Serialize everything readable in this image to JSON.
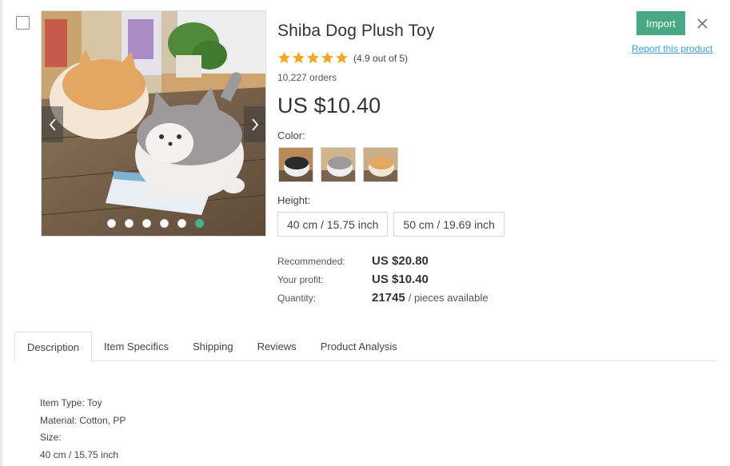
{
  "product": {
    "title": "Shiba Dog Plush Toy",
    "rating_value": 4.9,
    "rating_text": "(4.9 out of 5)",
    "orders": "10,227 orders",
    "price": "US $10.40"
  },
  "actions": {
    "import_label": "Import",
    "report_label": "Report this product"
  },
  "gallery": {
    "image_count": 6,
    "active_index": 5
  },
  "options": {
    "color_label": "Color:",
    "colors": [
      "black-shiba-swatch",
      "grey-shiba-swatch",
      "tan-shiba-swatch"
    ],
    "height_label": "Height:",
    "heights": [
      "40 cm / 15.75 inch",
      "50 cm / 19.69 inch"
    ]
  },
  "stats": {
    "recommended_label": "Recommended:",
    "recommended_value": "US $20.80",
    "profit_label": "Your profit:",
    "profit_value": "US $10.40",
    "quantity_label": "Quantity:",
    "quantity_value": "21745",
    "quantity_unit": "/ pieces available"
  },
  "tabs": [
    {
      "label": "Description",
      "active": true
    },
    {
      "label": "Item Specifics",
      "active": false
    },
    {
      "label": "Shipping",
      "active": false
    },
    {
      "label": "Reviews",
      "active": false
    },
    {
      "label": "Product Analysis",
      "active": false
    }
  ],
  "description": {
    "lines": [
      "Item Type: Toy",
      "Material: Cotton, PP",
      "Size:",
      "40 cm / 15.75 inch"
    ]
  },
  "colors": {
    "accent": "#4aa985",
    "active_dot": "#4db08a",
    "link": "#3d9bd9",
    "star": "#f5a623"
  }
}
